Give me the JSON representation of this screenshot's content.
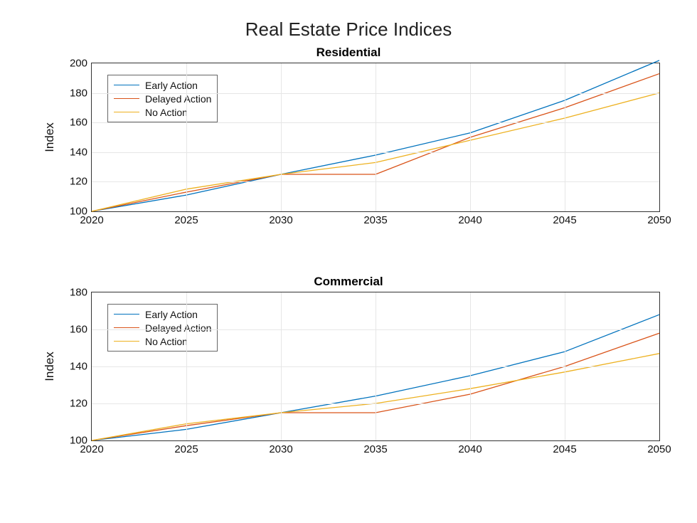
{
  "suptitle": "Real Estate Price Indices",
  "colors": {
    "series1": "#0072BD",
    "series2": "#D95319",
    "series3": "#EDB120"
  },
  "chart_data": [
    {
      "type": "line",
      "title": "Residential",
      "xlabel": "",
      "ylabel": "Index",
      "xlim": [
        2020,
        2050
      ],
      "ylim": [
        100,
        200
      ],
      "xticks": [
        2020,
        2025,
        2030,
        2035,
        2040,
        2045,
        2050
      ],
      "yticks": [
        100,
        120,
        140,
        160,
        180,
        200
      ],
      "legend": [
        "Early Action",
        "Delayed Action",
        "No Action"
      ],
      "legend_position": "upper-left-inset",
      "x": [
        2020,
        2025,
        2030,
        2035,
        2040,
        2045,
        2050
      ],
      "series": [
        {
          "name": "Early Action",
          "values": [
            100,
            111,
            125,
            138,
            153,
            175,
            202
          ]
        },
        {
          "name": "Delayed Action",
          "values": [
            100,
            113,
            125,
            125,
            150,
            170,
            193
          ]
        },
        {
          "name": "No Action",
          "values": [
            100,
            115,
            125,
            133,
            148,
            163,
            180
          ]
        }
      ]
    },
    {
      "type": "line",
      "title": "Commercial",
      "xlabel": "",
      "ylabel": "Index",
      "xlim": [
        2020,
        2050
      ],
      "ylim": [
        100,
        180
      ],
      "xticks": [
        2020,
        2025,
        2030,
        2035,
        2040,
        2045,
        2050
      ],
      "yticks": [
        100,
        120,
        140,
        160,
        180
      ],
      "legend": [
        "Early Action",
        "Delayed Action",
        "No Action"
      ],
      "legend_position": "upper-left-inset",
      "x": [
        2020,
        2025,
        2030,
        2035,
        2040,
        2045,
        2050
      ],
      "series": [
        {
          "name": "Early Action",
          "values": [
            100,
            106,
            115,
            124,
            135,
            148,
            168
          ]
        },
        {
          "name": "Delayed Action",
          "values": [
            100,
            108,
            115,
            115,
            125,
            140,
            158
          ]
        },
        {
          "name": "No Action",
          "values": [
            100,
            109,
            115,
            120,
            128,
            137,
            147
          ]
        }
      ]
    }
  ]
}
